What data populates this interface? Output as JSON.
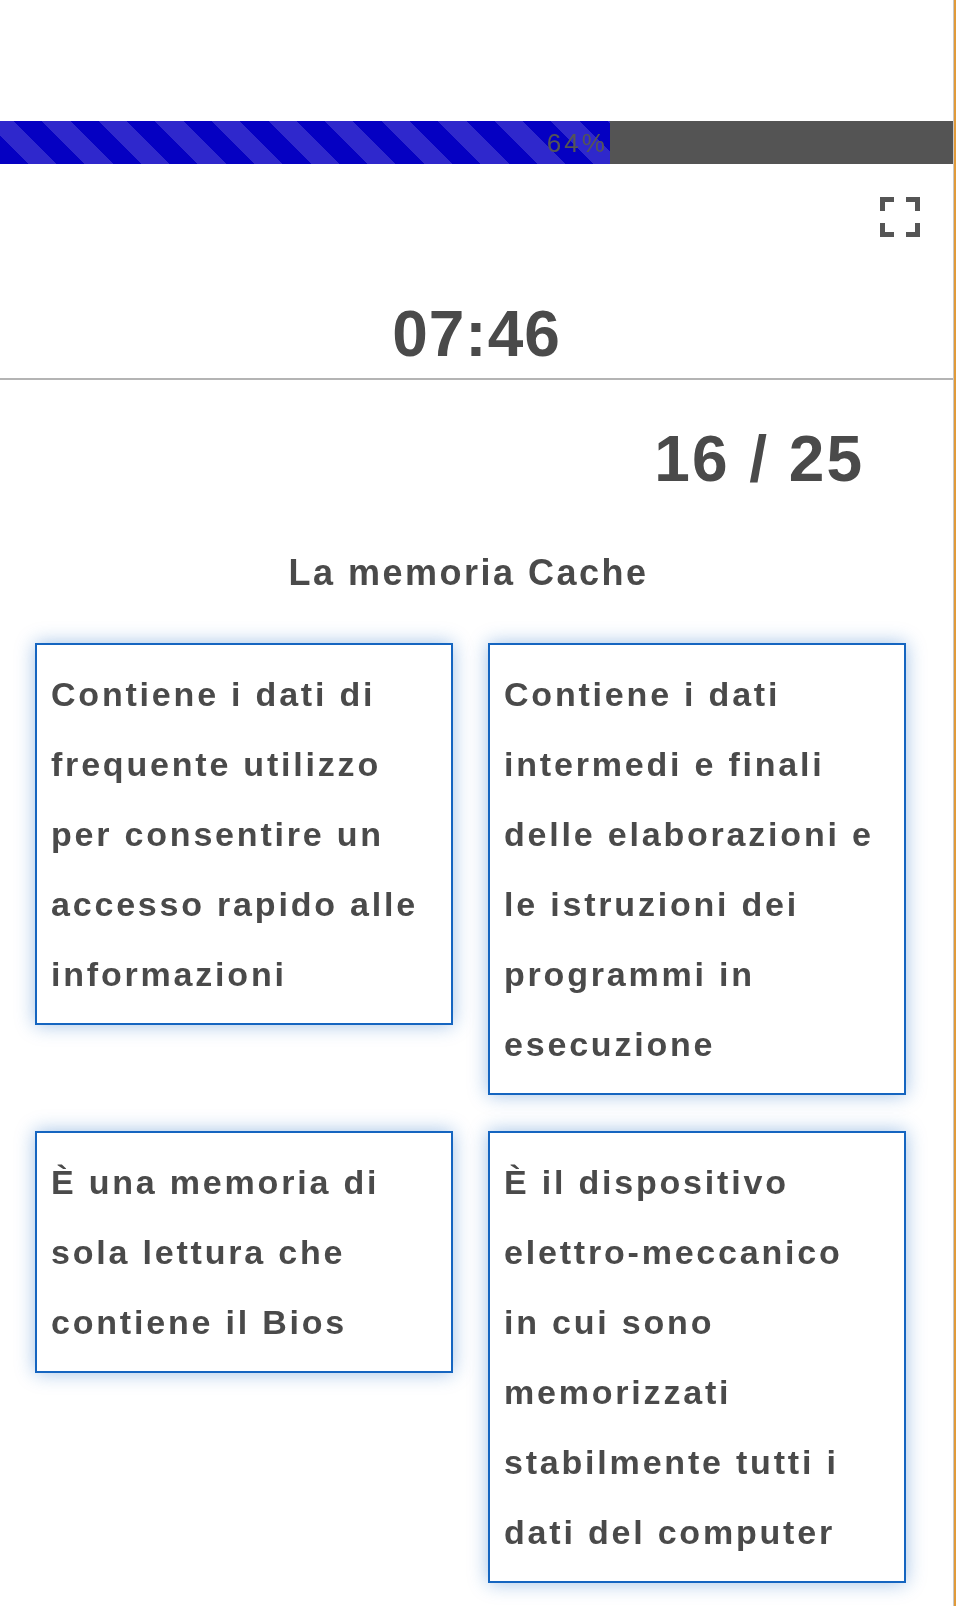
{
  "progress": {
    "level": 0.64,
    "label": "64%"
  },
  "timer": "07:46",
  "question_counter": "16 / 25",
  "question": "La memoria Cache",
  "answers": [
    {
      "text": "Contiene i dati di frequente utilizzo per consentire un accesso rapido alle informazioni"
    },
    {
      "text": "Contiene i dati intermedi e finali delle elaborazioni e le istruzioni dei programmi in esecuzione"
    },
    {
      "text": "È una memoria di sola lettura che contiene il Bios"
    },
    {
      "text": "È il dispositivo elettro-meccanico in cui sono memorizzati stabilmente tutti i dati del computer"
    }
  ]
}
